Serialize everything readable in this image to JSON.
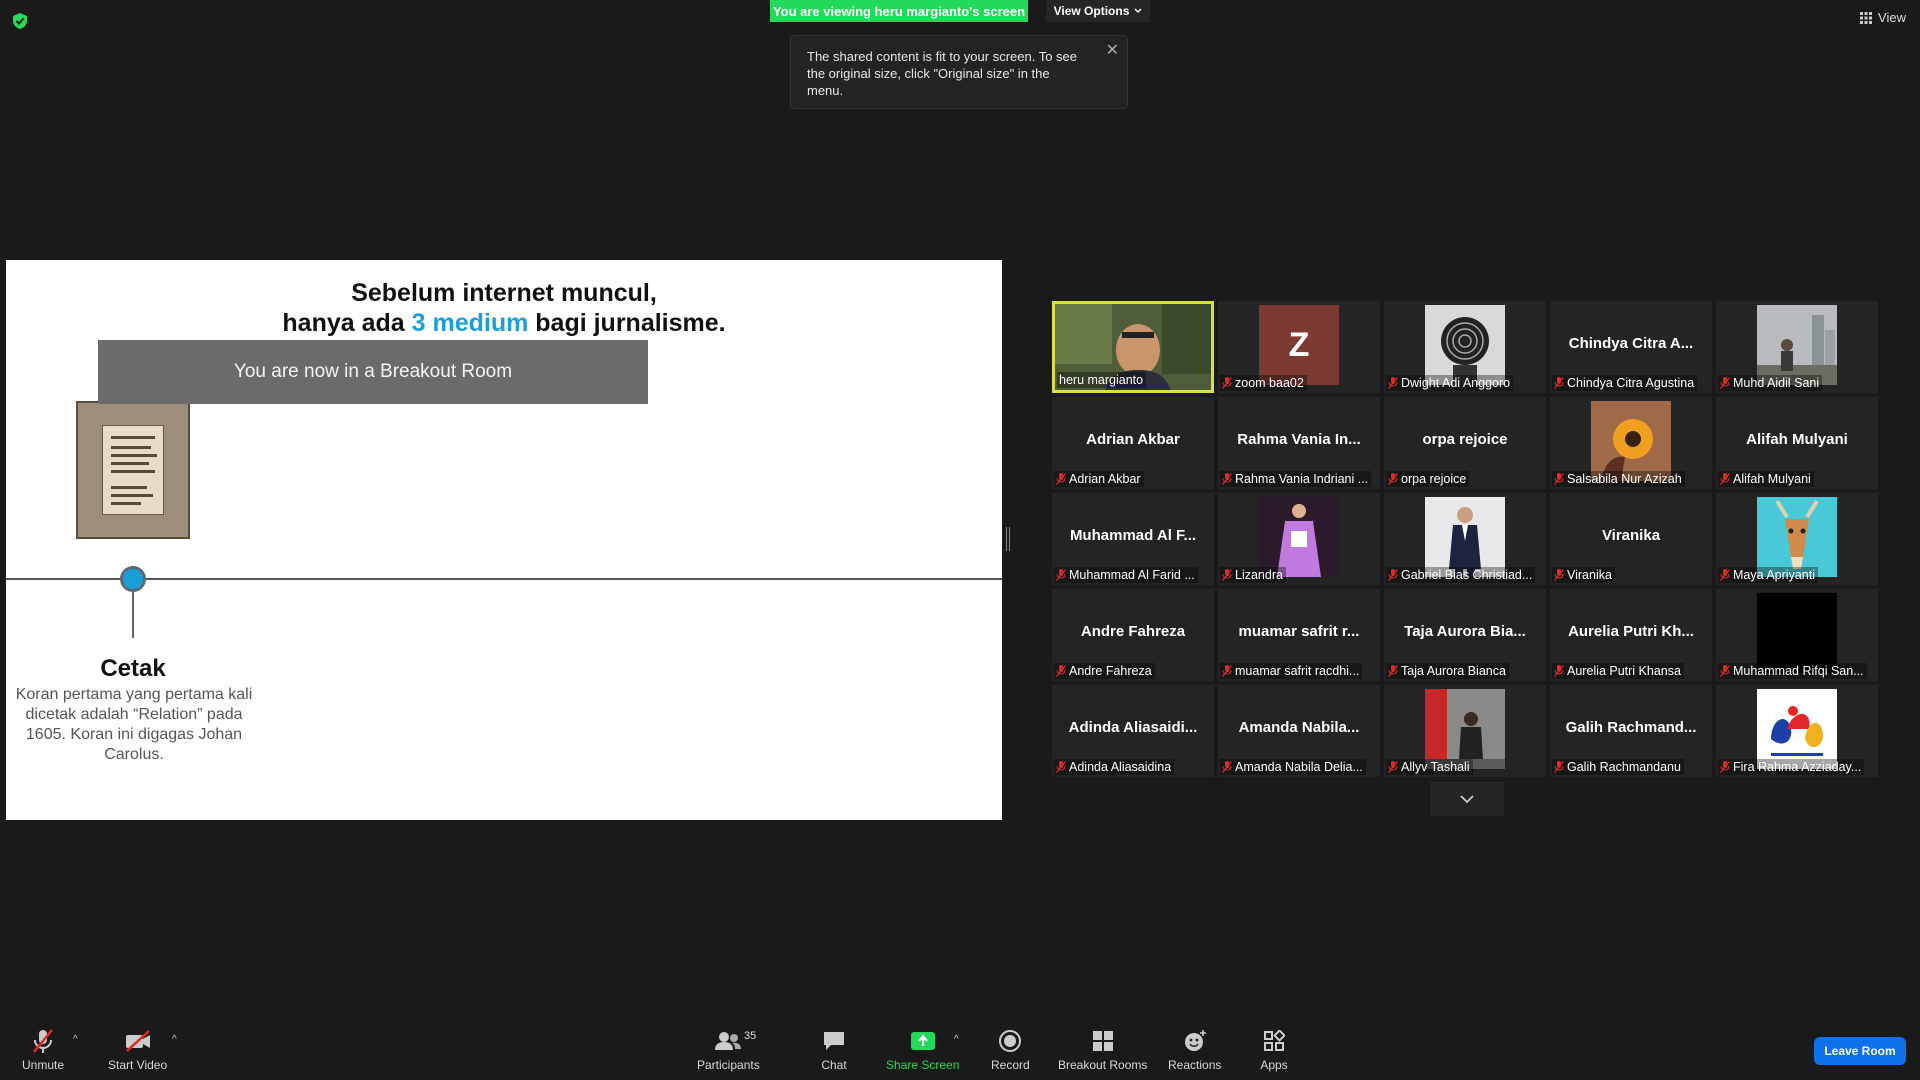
{
  "top": {
    "viewing_banner": "You are viewing heru margianto's screen",
    "view_options_label": "View Options",
    "view_label": "View"
  },
  "tooltip": {
    "text": "The shared content is fit to your screen. To see the original size, click \"Original size\" in the menu."
  },
  "slide": {
    "title_line1": "Sebelum internet muncul,",
    "title_line2_pre": "hanya ada ",
    "title_line2_highlight": "3 medium",
    "title_line2_post": " bagi jurnalisme.",
    "breakout_banner": "You are now in a Breakout Room",
    "cetak_title": "Cetak",
    "cetak_text": "Koran pertama yang pertama kali dicetak adalah “Relation” pada 1605. Koran ini digagas Johan Carolus.",
    "highlight_color": "#1a9fd6"
  },
  "participants": [
    {
      "big": "",
      "label": "heru margianto",
      "muted": false,
      "video": "person"
    },
    {
      "big": "",
      "label": "zoom baa02",
      "muted": true,
      "video": "z-avatar",
      "avatar_letter": "Z"
    },
    {
      "big": "",
      "label": "Dwight Adi Anggoro",
      "muted": true,
      "video": "fingerprint"
    },
    {
      "big": "Chindya Citra A...",
      "label": "Chindya Citra Agustina",
      "muted": true,
      "video": "none"
    },
    {
      "big": "",
      "label": "Muhd Aidil Sani",
      "muted": true,
      "video": "city"
    },
    {
      "big": "Adrian Akbar",
      "label": "Adrian Akbar",
      "muted": true,
      "video": "none"
    },
    {
      "big": "Rahma Vania In...",
      "label": "Rahma Vania Indriani ...",
      "muted": true,
      "video": "none"
    },
    {
      "big": "orpa rejoice",
      "label": "orpa rejoice",
      "muted": true,
      "video": "none"
    },
    {
      "big": "",
      "label": "Salsabila Nur Azizah",
      "muted": true,
      "video": "flower"
    },
    {
      "big": "Alifah Mulyani",
      "label": "Alifah Mulyani",
      "muted": true,
      "video": "none"
    },
    {
      "big": "Muhammad Al F...",
      "label": "Muhammad Al Farid ...",
      "muted": true,
      "video": "none"
    },
    {
      "big": "",
      "label": "Lizandra",
      "muted": true,
      "video": "purple"
    },
    {
      "big": "",
      "label": "Gabriel Bias Christiad...",
      "muted": true,
      "video": "suit"
    },
    {
      "big": "Viranika",
      "label": "Viranika",
      "muted": true,
      "video": "none"
    },
    {
      "big": "",
      "label": "Maya Apriyanti",
      "muted": true,
      "video": "deer"
    },
    {
      "big": "Andre Fahreza",
      "label": "Andre Fahreza",
      "muted": true,
      "video": "none"
    },
    {
      "big": "muamar safrit r...",
      "label": "muamar safrit racdhi...",
      "muted": true,
      "video": "none"
    },
    {
      "big": "Taja Aurora Bia...",
      "label": "Taja Aurora Bianca",
      "muted": true,
      "video": "none"
    },
    {
      "big": "Aurelia Putri Kh...",
      "label": "Aurelia Putri Khansa",
      "muted": true,
      "video": "none"
    },
    {
      "big": "",
      "label": "Muhammad Rifqi San...",
      "muted": true,
      "video": "black"
    },
    {
      "big": "Adinda  Aliasaidi...",
      "label": "Adinda Aliasaidina",
      "muted": true,
      "video": "none"
    },
    {
      "big": "Amanda  Nabila...",
      "label": "Amanda Nabila Delia...",
      "muted": true,
      "video": "none"
    },
    {
      "big": "",
      "label": "Allyv Tashali",
      "muted": true,
      "video": "red"
    },
    {
      "big": "Galih  Rachmand...",
      "label": "Galih Rachmandanu",
      "muted": true,
      "video": "none"
    },
    {
      "big": "",
      "label": "Fira Rahma Azziaday...",
      "muted": true,
      "video": "logo"
    }
  ],
  "toolbar": {
    "unmute": "Unmute",
    "start_video": "Start Video",
    "participants": "Participants",
    "participant_count": "35",
    "chat": "Chat",
    "share_screen": "Share Screen",
    "record": "Record",
    "breakout_rooms": "Breakout Rooms",
    "reactions": "Reactions",
    "apps": "Apps",
    "leave_room": "Leave Room"
  }
}
